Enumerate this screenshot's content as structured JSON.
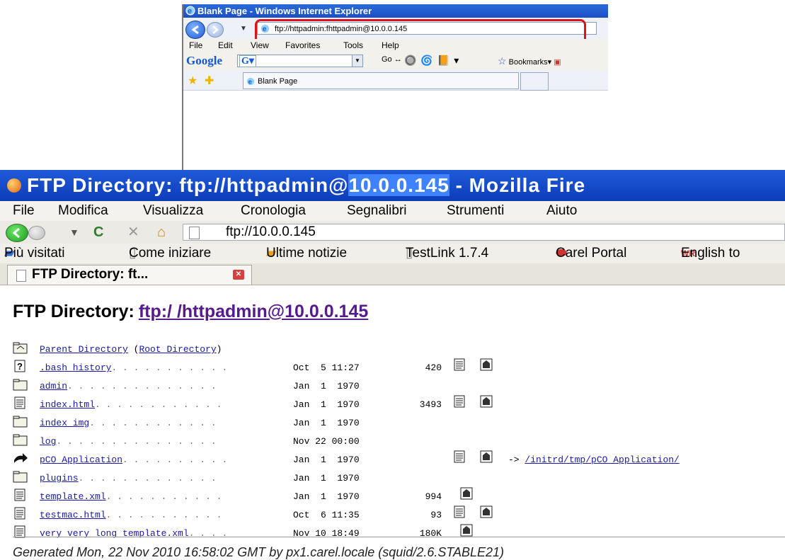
{
  "ie": {
    "title": "Blank Page - Windows Internet Explorer",
    "address": "ftp://httpadmin:fhttpadmin@10.0.0.145",
    "menu": [
      "File",
      "Edit",
      "View",
      "Favorites",
      "Tools",
      "Help"
    ],
    "google_label": "Google",
    "go_label": "Go",
    "bookmarks_label": "Bookmarks",
    "tab_label": "Blank Page"
  },
  "ff": {
    "title_prefix": "FTP Directory: ftp://httpadmin@",
    "title_highlight": "10.0.0.145",
    "title_suffix": " -  Mozilla Fire",
    "menu": [
      "File",
      "Modifica",
      "Visualizza",
      "Cronologia",
      "Segnalibri",
      "Strumenti",
      "Aiuto"
    ],
    "url": "ftp://10.0.0.145",
    "bookmarks": [
      "Più visitati",
      "Come iniziare",
      "Ultime notizie",
      "TestLink 1.7.4",
      "Carel Portal",
      "English to"
    ],
    "tab_label": "FTP Directory: ft..."
  },
  "page": {
    "heading": "FTP Directory:",
    "heading_link": "ftp:/ /httpadmin@10.0.0.145",
    "parent_link": "Parent Directory",
    "root_link": "Root Directory",
    "footer": "Generated Mon, 22 Nov 2010 16:58:02 GMT by px1.carel.locale (squid/2.6.STABLE21)"
  },
  "files": [
    {
      "name": ".bash_history",
      "dots": ". . . . . . . . . . .",
      "date": "Oct  5 11:27",
      "size": "420",
      "type": "unknown",
      "icons": "both"
    },
    {
      "name": "admin",
      "dots": ". . . . . . . . . . . . . .",
      "date": "Jan  1  1970",
      "size": "",
      "type": "folder",
      "icons": "none"
    },
    {
      "name": "index.html",
      "dots": ". . . . . . . . . . . .",
      "date": "Jan  1  1970",
      "size": "3493",
      "type": "file",
      "icons": "both"
    },
    {
      "name": "index_img",
      "dots": ". . . . . . . . . . . .",
      "date": "Jan  1  1970",
      "size": "",
      "type": "folder",
      "icons": "none"
    },
    {
      "name": "log",
      "dots": ". . . . . . . . . . . . . . .",
      "date": "Nov 22 00:00",
      "size": "",
      "type": "folder",
      "icons": "none"
    },
    {
      "name": "pCO_Application",
      "dots": ". . . . . . . . . .",
      "date": "Jan  1  1970",
      "size": "",
      "type": "link",
      "icons": "both",
      "target": "/initrd/tmp/pCO_Application/"
    },
    {
      "name": "plugins",
      "dots": ". . . . . . . . . . . . .",
      "date": "Jan  1  1970",
      "size": "",
      "type": "folder",
      "icons": "none"
    },
    {
      "name": "template.xml",
      "dots": ". . . . . . . . . . .",
      "date": "Jan  1  1970",
      "size": "994",
      "type": "file",
      "icons": "download"
    },
    {
      "name": "testmac.html",
      "dots": ". . . . . . . . . . .",
      "date": "Oct  6 11:35",
      "size": "93",
      "type": "file",
      "icons": "both"
    },
    {
      "name": "very_very_long_template.xml",
      "dots": ". . . .",
      "date": "Nov 10 18:49",
      "size": "180K",
      "type": "file",
      "icons": "download"
    }
  ],
  "colors": {
    "ie_titlebar": "#1c4fc4",
    "ff_titlebar": "#0d3cb8",
    "highlight_box": "#d9141b",
    "link": "#1a1aa6",
    "visited_link": "#551a8b"
  }
}
